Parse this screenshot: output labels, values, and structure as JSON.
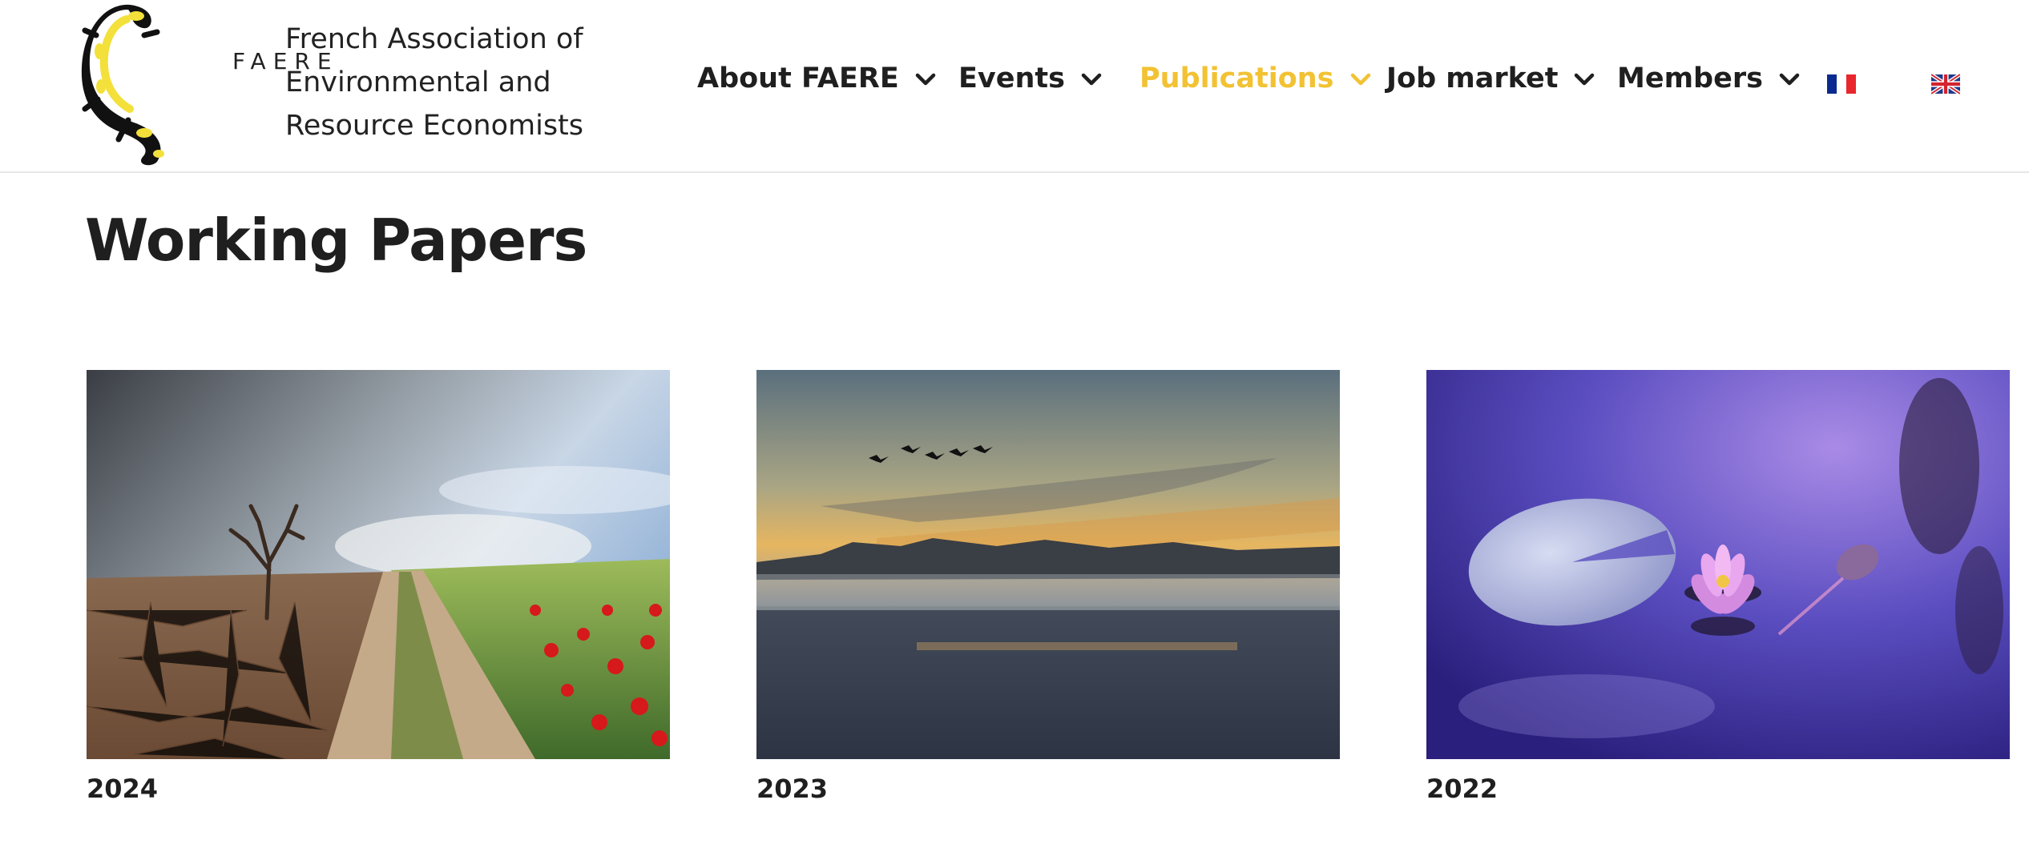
{
  "header": {
    "logo_text": "FAERE",
    "org_name_lines": [
      "French Association of",
      "Environmental and",
      "Resource Economists"
    ]
  },
  "nav": {
    "items": [
      {
        "label": "About FAERE",
        "active": false
      },
      {
        "label": "Events",
        "active": false
      },
      {
        "label": "Publications",
        "active": true
      },
      {
        "label": "Job market",
        "active": false
      },
      {
        "label": "Members",
        "active": false
      }
    ],
    "languages": [
      {
        "icon": "french-flag-icon"
      },
      {
        "icon": "uk-flag-icon"
      }
    ],
    "active_color": "#f2c233"
  },
  "page": {
    "title": "Working Papers"
  },
  "cards": [
    {
      "year": "2024",
      "image": "drought-and-poppy-field-image"
    },
    {
      "year": "2023",
      "image": "misty-lake-sunset-image"
    },
    {
      "year": "2022",
      "image": "water-lily-image"
    }
  ]
}
